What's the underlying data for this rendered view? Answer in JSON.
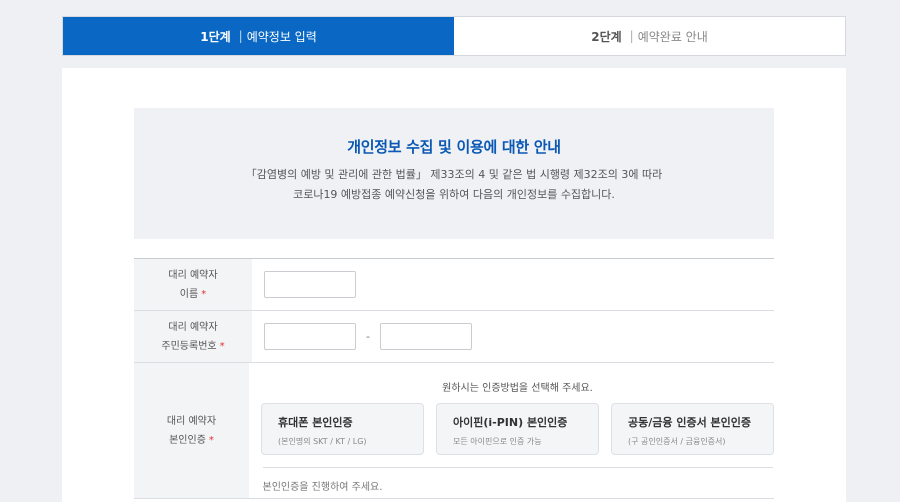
{
  "steps": [
    {
      "num": "1단계",
      "sep": "|",
      "label": "예약정보 입력",
      "active": true
    },
    {
      "num": "2단계",
      "sep": "|",
      "label": "예약완료 안내",
      "active": false
    }
  ],
  "notice": {
    "title": "개인정보 수집 및 이용에 대한 안내",
    "line1": "「감염병의 예방 및 관리에 관한 법률」 제33조의 4 및 같은 법 시행령 제32조의 3에 따라",
    "line2": "코로나19 예방접종 예약신청을 위하여 다음의 개인정보를 수집합니다."
  },
  "form": {
    "name": {
      "label_l1": "대리 예약자",
      "label_l2": "이름",
      "required": "*",
      "value": ""
    },
    "rrn": {
      "label_l1": "대리 예약자",
      "label_l2": "주민등록번호",
      "required": "*",
      "front": "",
      "back": "",
      "separator": "-"
    },
    "cert": {
      "label_l1": "대리 예약자",
      "label_l2": "본인인증",
      "required": "*",
      "hint": "원하시는 인증방법을 선택해 주세요.",
      "options": [
        {
          "title": "휴대폰 본인인증",
          "sub": "(본인명의 SKT / KT / LG)"
        },
        {
          "title": "아이핀(i-PIN) 본인인증",
          "sub": "모든 아이핀으로 인증 가능"
        },
        {
          "title": "공동/금융 인증서 본인인증",
          "sub": "(구 공인인증서 / 금융인증서)"
        }
      ],
      "status": "본인인증을 진행하여 주세요."
    }
  },
  "colors": {
    "accent": "#0a68c4",
    "notice_title": "#0a58b4",
    "required": "#e03131"
  }
}
